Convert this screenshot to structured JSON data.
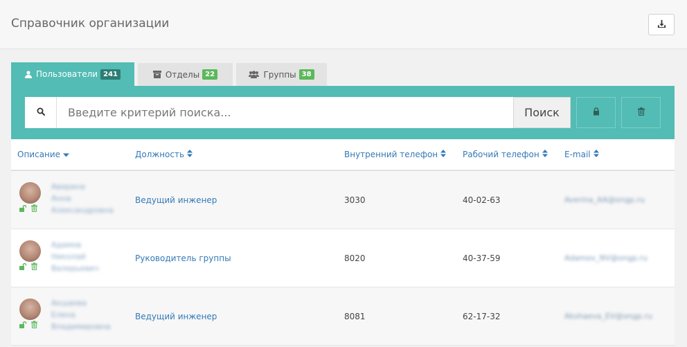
{
  "header": {
    "title": "Справочник организации",
    "download_icon": "download-icon"
  },
  "tabs": [
    {
      "label": "Пользователи",
      "count": "241",
      "icon": "user-icon"
    },
    {
      "label": "Отделы",
      "count": "22",
      "icon": "archive-icon"
    },
    {
      "label": "Группы",
      "count": "38",
      "icon": "users-icon"
    }
  ],
  "toolbar": {
    "search_placeholder": "Введите критерий поиска...",
    "search_value": "",
    "search_button": "Поиск",
    "lock_icon": "lock-icon",
    "trash_icon": "trash-icon"
  },
  "table": {
    "columns": [
      "Описание",
      "Должность",
      "Внутренний телефон",
      "Рабочий телефон",
      "E-mail"
    ],
    "rows": [
      {
        "name": [
          "Аверина",
          "Анна",
          "Александровна"
        ],
        "position": "Ведущий инженер",
        "internal_phone": "3030",
        "work_phone": "40-02-63",
        "email": "Averina_AA@ongp.ru"
      },
      {
        "name": [
          "Адамов",
          "Николай",
          "Валерьевич"
        ],
        "position": "Руководитель группы",
        "internal_phone": "8020",
        "work_phone": "40-37-59",
        "email": "Adamov_NV@ongp.ru"
      },
      {
        "name": [
          "Акшаева",
          "Елена",
          "Владимировна"
        ],
        "position": "Ведущий инженер",
        "internal_phone": "8081",
        "work_phone": "62-17-32",
        "email": "Akshaeva_EV@ongp.ru"
      }
    ]
  },
  "colors": {
    "accent": "#53bcb4",
    "link": "#337ab7",
    "badge_dark": "#2d7d74",
    "badge_green": "#5cb85c",
    "row_icon_green": "#5cb85c"
  }
}
